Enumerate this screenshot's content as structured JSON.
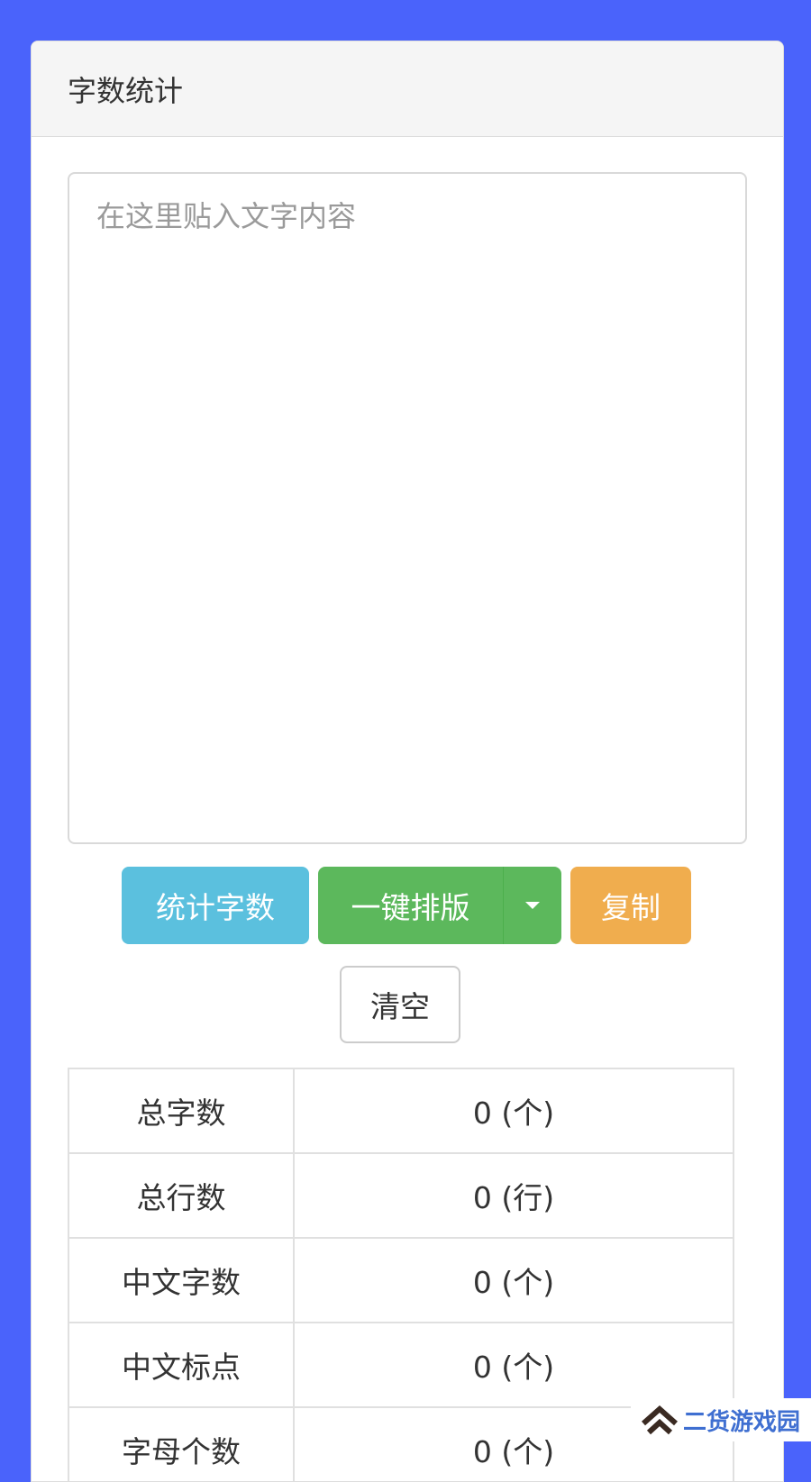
{
  "panel": {
    "title": "字数统计"
  },
  "editor": {
    "placeholder": "在这里贴入文字内容",
    "value": ""
  },
  "buttons": {
    "count": "统计字数",
    "format": "一键排版",
    "copy": "复制",
    "clear": "清空"
  },
  "stats": [
    {
      "label": "总字数",
      "value": "0 (个)"
    },
    {
      "label": "总行数",
      "value": "0 (行)"
    },
    {
      "label": "中文字数",
      "value": "0 (个)"
    },
    {
      "label": "中文标点",
      "value": "0 (个)"
    },
    {
      "label": "字母个数",
      "value": "0 (个)"
    }
  ],
  "watermark": {
    "text": "二货游戏园",
    "icon": "double-chevron-up-icon"
  },
  "colors": {
    "background": "#4a63fb",
    "info": "#5bc0de",
    "success": "#5cb85c",
    "warning": "#f0ad4e"
  }
}
